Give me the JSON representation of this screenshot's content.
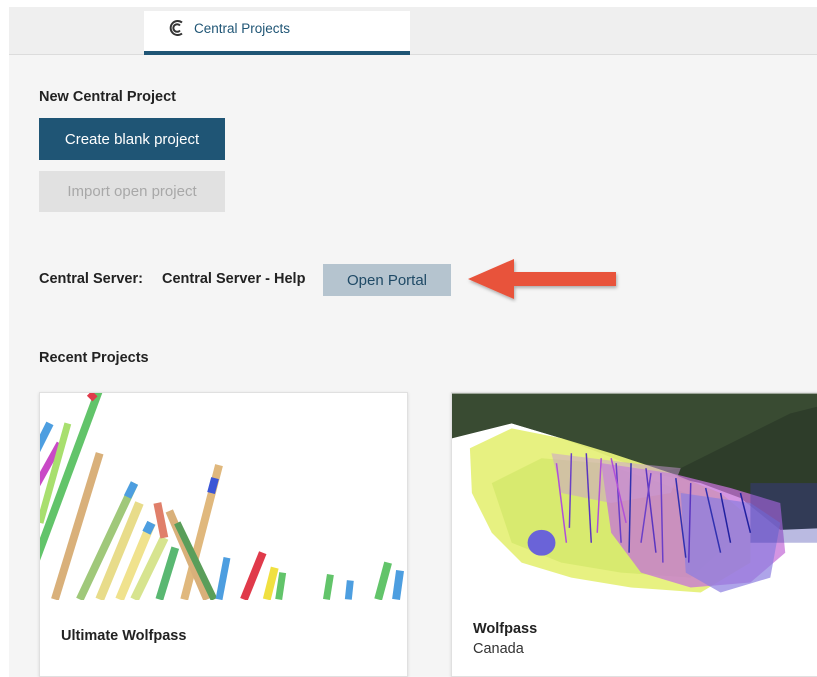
{
  "tabs": [
    {
      "label": "Central Projects",
      "icon": "central-logo-icon",
      "active": true
    }
  ],
  "new_project": {
    "heading": "New Central Project",
    "create_label": "Create blank project",
    "import_label": "Import open project"
  },
  "server": {
    "label": "Central Server:",
    "name": "Central Server - Help",
    "open_portal_label": "Open Portal"
  },
  "recent": {
    "heading": "Recent Projects",
    "projects": [
      {
        "name": "Ultimate Wolfpass",
        "subtitle": ""
      },
      {
        "name": "Wolfpass",
        "subtitle": "Canada"
      }
    ]
  },
  "colors": {
    "accent": "#1f5575",
    "portal_button": "#b5c4cf",
    "annotation_arrow": "#e8523a"
  }
}
